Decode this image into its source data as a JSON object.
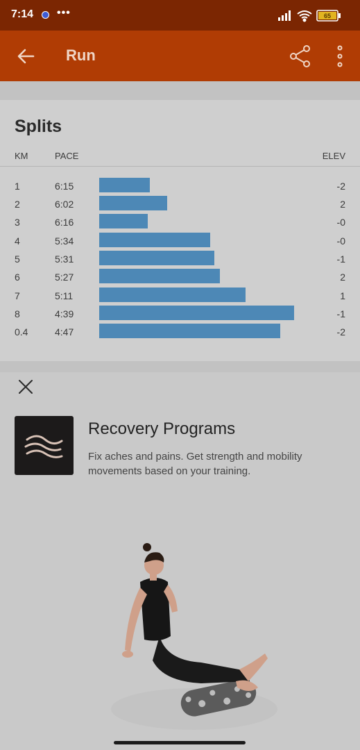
{
  "status": {
    "time": "7:14",
    "more": "•••",
    "battery": "65"
  },
  "appbar": {
    "title": "Run"
  },
  "splits": {
    "title": "Splits",
    "headers": {
      "km": "KM",
      "pace": "PACE",
      "elev": "ELEV"
    },
    "rows": [
      {
        "km": "1",
        "pace": "6:15",
        "elev": "-2",
        "bar_fraction": 0.26
      },
      {
        "km": "2",
        "pace": "6:02",
        "elev": "2",
        "bar_fraction": 0.35
      },
      {
        "km": "3",
        "pace": "6:16",
        "elev": "-0",
        "bar_fraction": 0.25
      },
      {
        "km": "4",
        "pace": "5:34",
        "elev": "-0",
        "bar_fraction": 0.57
      },
      {
        "km": "5",
        "pace": "5:31",
        "elev": "-1",
        "bar_fraction": 0.59
      },
      {
        "km": "6",
        "pace": "5:27",
        "elev": "2",
        "bar_fraction": 0.62
      },
      {
        "km": "7",
        "pace": "5:11",
        "elev": "1",
        "bar_fraction": 0.75
      },
      {
        "km": "8",
        "pace": "4:39",
        "elev": "-1",
        "bar_fraction": 1.0
      },
      {
        "km": "0.4",
        "pace": "4:47",
        "elev": "-2",
        "bar_fraction": 0.93
      }
    ]
  },
  "promo": {
    "title": "Recovery Programs",
    "description": "Fix aches and pains. Get strength and mobility movements based on your training."
  }
}
